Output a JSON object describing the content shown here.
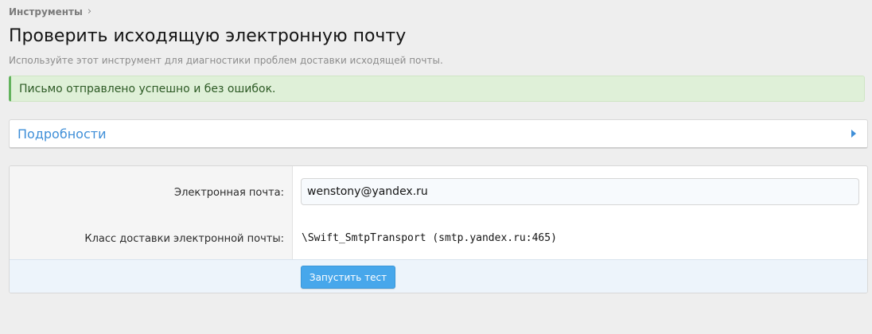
{
  "breadcrumb": {
    "items": [
      {
        "label": "Инструменты"
      }
    ],
    "separator_icon": "chevron-right-icon"
  },
  "header": {
    "title": "Проверить исходящую электронную почту",
    "description": "Используйте этот инструмент для диагностики проблем доставки исходящей почты."
  },
  "alert": {
    "message": "Письмо отправлено успешно и без ошибок.",
    "color": "#dff0d8",
    "accent": "#63b35d"
  },
  "details": {
    "label": "Подробности",
    "expand_icon": "triangle-right-icon",
    "color": "#3f8fd8"
  },
  "form": {
    "email": {
      "label": "Электронная почта:",
      "value": "wenstony@yandex.ru"
    },
    "transport": {
      "label": "Класс доставки электронной почты:",
      "value": "\\Swift_SmtpTransport (smtp.yandex.ru:465)"
    },
    "submit": {
      "label": "Запустить тест",
      "color": "#47a7eb"
    }
  }
}
